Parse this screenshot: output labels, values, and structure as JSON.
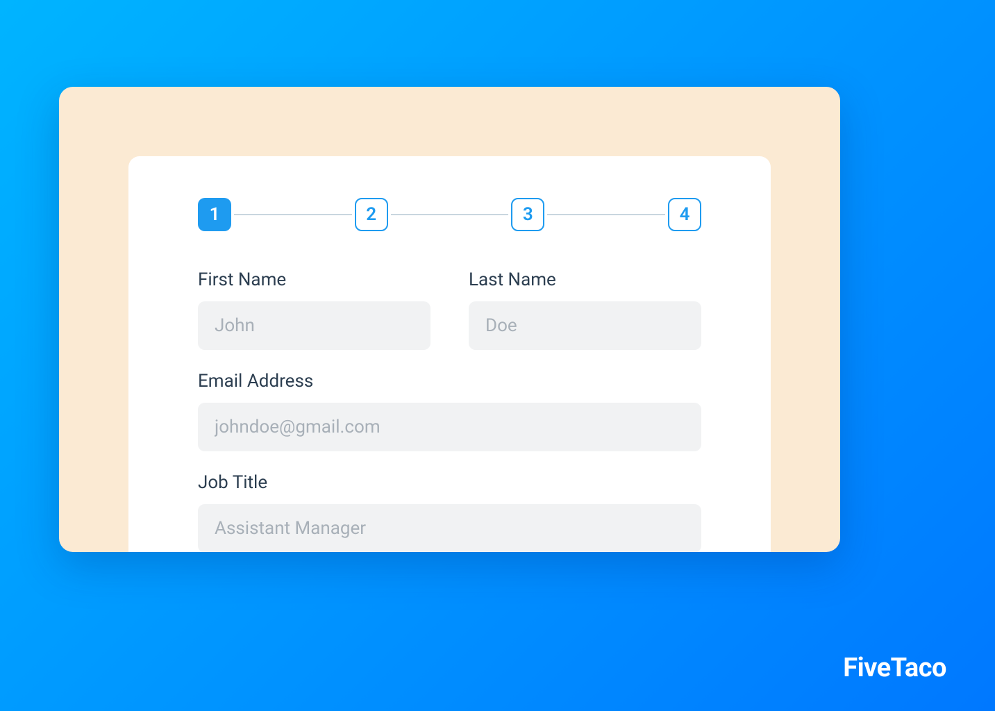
{
  "brand": "FiveTaco",
  "stepper": {
    "steps": [
      "1",
      "2",
      "3",
      "4"
    ],
    "activeIndex": 0
  },
  "form": {
    "firstName": {
      "label": "First Name",
      "placeholder": "John"
    },
    "lastName": {
      "label": "Last Name",
      "placeholder": "Doe"
    },
    "email": {
      "label": "Email Address",
      "placeholder": "johndoe@gmail.com"
    },
    "jobTitle": {
      "label": "Job Title",
      "placeholder": "Assistant Manager"
    }
  }
}
